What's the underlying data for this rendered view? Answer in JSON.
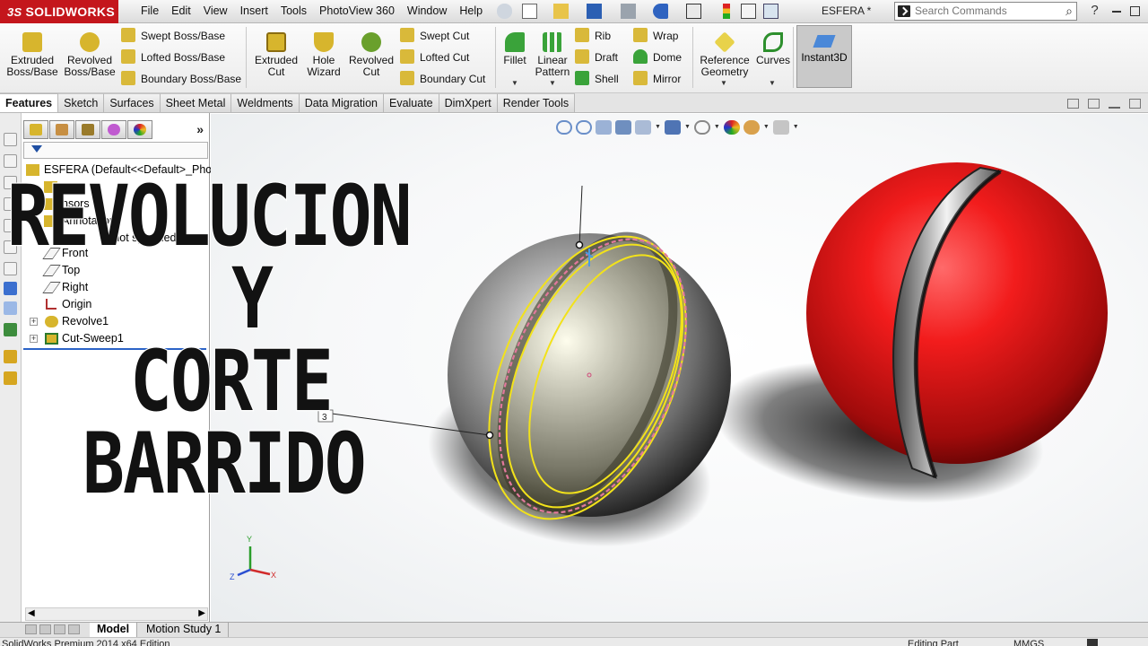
{
  "titlebar": {
    "logo_brand": "SOLIDWORKS",
    "menus": [
      "File",
      "Edit",
      "View",
      "Insert",
      "Tools",
      "PhotoView 360",
      "Window",
      "Help"
    ],
    "document_title": "ESFERA *",
    "search_placeholder": "Search Commands"
  },
  "command_manager": {
    "extruded_boss": "Extruded\nBoss/Base",
    "revolved_boss": "Revolved\nBoss/Base",
    "swept_boss": "Swept Boss/Base",
    "lofted_boss": "Lofted Boss/Base",
    "boundary_boss": "Boundary Boss/Base",
    "extruded_cut": "Extruded\nCut",
    "hole_wizard": "Hole\nWizard",
    "revolved_cut": "Revolved\nCut",
    "swept_cut": "Swept Cut",
    "lofted_cut": "Lofted Cut",
    "boundary_cut": "Boundary Cut",
    "fillet": "Fillet",
    "linear_pattern": "Linear\nPattern",
    "rib": "Rib",
    "draft": "Draft",
    "shell": "Shell",
    "wrap": "Wrap",
    "dome": "Dome",
    "mirror": "Mirror",
    "reference_geometry": "Reference\nGeometry",
    "curves": "Curves",
    "instant3d": "Instant3D"
  },
  "tabs": [
    "Features",
    "Sketch",
    "Surfaces",
    "Sheet Metal",
    "Weldments",
    "Data Migration",
    "Evaluate",
    "DimXpert",
    "Render Tools"
  ],
  "active_tab": "Features",
  "feature_tree": {
    "root": "ESFERA  (Default<<Default>_Phot",
    "visible_partial_rows": [
      "Se",
      "nsors",
      "Annotations",
      "<not specified"
    ],
    "items": [
      {
        "label": "Front",
        "icon": "plane-icon"
      },
      {
        "label": "Top",
        "icon": "plane-icon"
      },
      {
        "label": "Right",
        "icon": "plane-icon"
      },
      {
        "label": "Origin",
        "icon": "origin-icon"
      },
      {
        "label": "Revolve1",
        "icon": "revolve-icon"
      },
      {
        "label": "Cut-Sweep1",
        "icon": "cut-sweep-icon"
      }
    ]
  },
  "viewport": {
    "triad_labels": {
      "x": "X",
      "y": "Y",
      "z": "Z"
    },
    "dimension_tag": "3"
  },
  "overlay_text": {
    "line1": "REVOLUCION",
    "line2": "Y",
    "line3": "CORTE",
    "line4": "BARRIDO"
  },
  "bottom_tabs": [
    "Model",
    "Motion Study 1"
  ],
  "status": {
    "left": "SolidWorks Premium 2014 x64 Edition",
    "mode": "Editing Part",
    "units": "MMGS"
  },
  "colors": {
    "brand_red": "#c4161c",
    "ball_red": "#e0171b",
    "sketch_yellow": "#f2e21a",
    "sketch_pink": "#e2789c"
  }
}
